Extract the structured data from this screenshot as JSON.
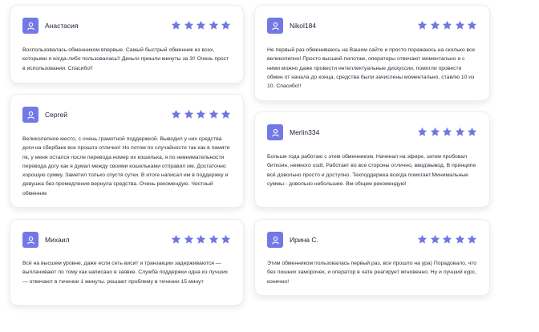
{
  "colors": {
    "accent": "#7279e6",
    "star": "#6f77e0",
    "card_bg": "#ffffff"
  },
  "icons": {
    "avatar": "user-icon",
    "rating": "star-icon"
  },
  "reviews": [
    {
      "name": "Анастасия",
      "rating": 5,
      "text": "Воспользовалась обменником впервые. Самый быстрый обменник из всех, которыми я когда-либо пользовалась!! Деньги пришли минуты за 3!! Очень прост в использовании. Спасибо!!"
    },
    {
      "name": "Nikol184",
      "rating": 5,
      "text": "Не первый раз обмениваюсь на Вашем сайте и просто поражаюсь на сколько все великолепно! Просто высший пилотаж, операторы отвечают моментально и с ними можно даже провести интеллектуальные дискуссии, помогли провести обмен от начала до конца, средства были зачислены моментально, ставлю 10 из 10. Спасибо!!"
    },
    {
      "name": "Сергей",
      "rating": 5,
      "text": "Великолепное место, с очень грамотной поддержкой. Выводил у них средства доги на сбербанк все прошло отлично! Но потом по случайности так как в памяти пк, у меня остался после перевода номер их кошелька, я по невнимательности перевода догу как я думал между своими кошельками отправил им. Достаточно хорошую сумму. Заметил только спустя сутки. В итоге написал им в поддержку и девушка без промедления вернула средства. Очень рекомендую. Честный обменник"
    },
    {
      "name": "Merlin334",
      "rating": 5,
      "text": "Больше года работаю с этим обменником. Начинал на эфире, затем пробовал биткоин, немного usdt. Работает во все стороны отлично, ввод\\вывод. В принципе всё довольно просто и доступно. Техподдержка всегда помогает.Минимальные суммы - довольно небольшие. Вм общем рекомендую!"
    },
    {
      "name": "Михаил",
      "rating": 5,
      "text": "Всё на высшем уровне, даже если сеть висит и транзакции задерживаются — выплачивают по тому как написано в заявке. Служба поддержки одна из лучших — отвечают в течении 1 минуты. решают проблему в течении 15 минут"
    },
    {
      "name": "Ирина С.",
      "rating": 5,
      "text": "Этим обменником пользовалась первый раз, все прошло на ура) Порадовало, что без лишних заморочек, и оператор в чате реагирует мгновенно. Ну и лучший курс, конечно!"
    }
  ]
}
